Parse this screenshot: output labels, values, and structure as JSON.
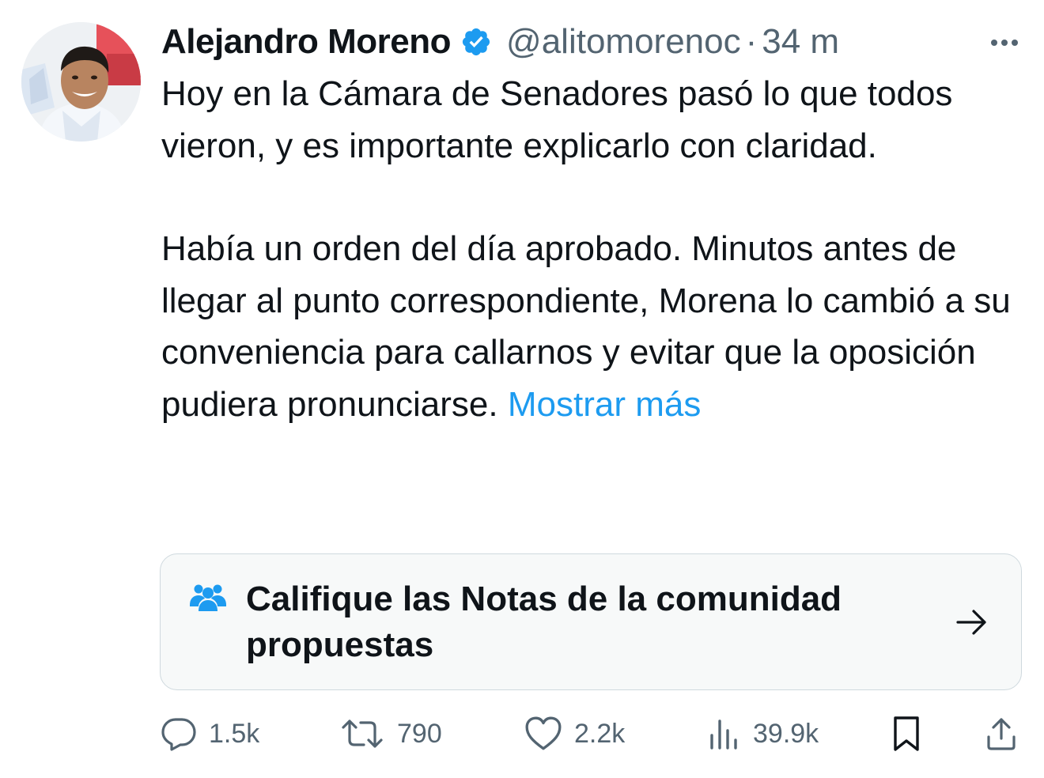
{
  "tweet": {
    "author": {
      "name": "Alejandro Moreno",
      "handle": "@alitomorenoc",
      "separator": "·",
      "time": "34 m",
      "verified": true,
      "verified_color": "#1d9bf0",
      "avatar_icon": "profile-photo"
    },
    "paragraphs": [
      "Hoy en la Cámara de Senadores pasó lo que todos vieron, y es importante explicarlo con claridad.",
      "Había un orden del día aprobado. Minutos antes de llegar al punto correspondiente, Morena lo cambió a su conveniencia para callarnos y evitar que la oposición pudiera pronunciarse."
    ],
    "show_more": "Mostrar más",
    "link_color": "#1d9bf0",
    "community_notes": {
      "text": "Califique las Notas de la comunidad propuestas",
      "icon": "people-icon",
      "icon_color": "#1d9bf0"
    },
    "actions": {
      "replies": "1.5k",
      "retweets": "790",
      "likes": "2.2k",
      "views": "39.9k"
    },
    "action_icon_color": "#536471"
  }
}
